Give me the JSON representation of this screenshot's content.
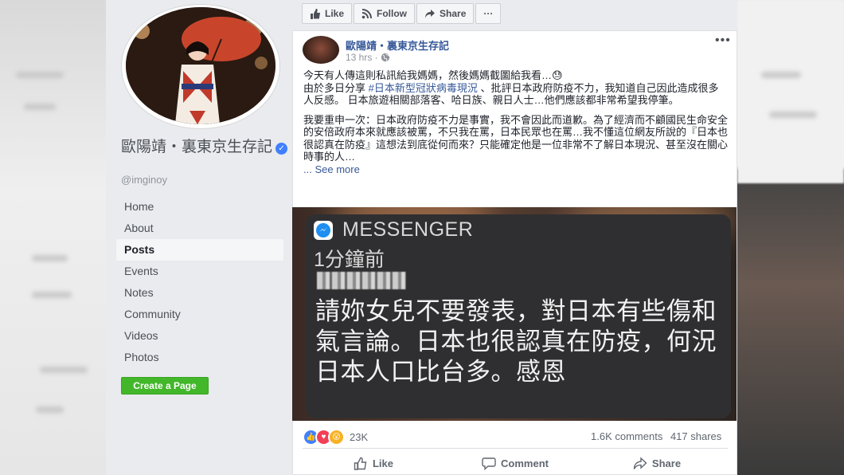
{
  "sidebar": {
    "page_name": "歐陽靖・裏東京生存記",
    "handle": "@imginoy",
    "nav": [
      {
        "label": "Home",
        "active": false
      },
      {
        "label": "About",
        "active": false
      },
      {
        "label": "Posts",
        "active": true
      },
      {
        "label": "Events",
        "active": false
      },
      {
        "label": "Notes",
        "active": false
      },
      {
        "label": "Community",
        "active": false
      },
      {
        "label": "Videos",
        "active": false
      },
      {
        "label": "Photos",
        "active": false
      }
    ],
    "create_page": "Create a Page"
  },
  "actionbar": {
    "like": "Like",
    "follow": "Follow",
    "share": "Share",
    "more": "···"
  },
  "post": {
    "author": "歐陽靖・裏東京生存記",
    "time": "13 hrs ·",
    "more": "•••",
    "line1": "今天有人傳這則私訊給我媽媽，然後媽媽截圖給我看…😓",
    "line2_pre": "由於多日分享 ",
    "hashtag": "#日本新型冠狀病毒現況",
    "line2_post": " 、批評日本政府防疫不力，我知道自己因此造成很多人反感。 日本旅遊相關部落客、哈日族、親日人士…他們應該都非常希望我停筆。",
    "line3": "我要重申一次：日本政府防疫不力是事實，我不會因此而道歉。為了經濟而不顧國民生命安全的安倍政府本來就應該被罵，不只我在罵，日本民眾也在罵…我不懂這位網友所說的『日本也很認真在防疫』這想法到底從何而來？只能確定他是一位非常不了解日本現況、甚至沒在關心時事的人…",
    "see_more": "... See more"
  },
  "screenshot": {
    "app": "MESSENGER",
    "time": "1分鐘前",
    "body": "請妳女兒不要發表，對日本有些傷和氣言論。日本也很認真在防疫，何況日本人口比台多。感恩"
  },
  "engagement": {
    "reactions": "23K",
    "comments": "1.6K comments",
    "shares": "417 shares"
  },
  "footer": {
    "like": "Like",
    "comment": "Comment",
    "share": "Share"
  },
  "colors": {
    "link": "#365899",
    "green": "#42b72a",
    "sidebar_bg": "#e9ebee"
  }
}
